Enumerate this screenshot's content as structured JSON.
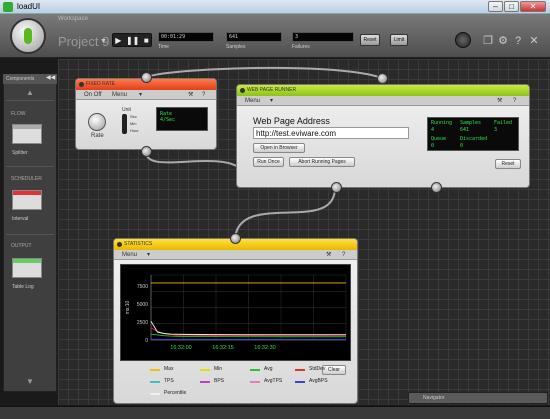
{
  "window": {
    "title": "loadUI"
  },
  "toolbar": {
    "workspace_label": "Workspace",
    "project_name": "Project 9",
    "time_value": "00:01:29",
    "time_label": "Time",
    "samples_value": "641",
    "samples_label": "Samples",
    "failures_value": "3",
    "failures_label": "Failures",
    "reset_label": "Reset",
    "limit_label": "Limit"
  },
  "sidebar": {
    "title": "Components",
    "sections": [
      {
        "label": "FLOW",
        "item": "Splitter"
      },
      {
        "label": "SCHEDULER",
        "item": "Interval"
      },
      {
        "label": "OUTPUT",
        "item": "Table Log"
      }
    ]
  },
  "fixed_rate": {
    "title": "FIXED RATE",
    "menu_label": "Menu",
    "onoff_label": "On Off",
    "unit_label": "Unit",
    "unit_options": [
      "Sec",
      "Min",
      "Hour"
    ],
    "rate_label": "Rate",
    "display_line1": "Rate",
    "display_line2": "4/Sec"
  },
  "web_runner": {
    "title": "WEB PAGE RUNNER",
    "menu_label": "Menu",
    "address_label": "Web Page Address",
    "address_value": "http://test.eviware.com",
    "open_browser_label": "Open in Browser",
    "run_once_label": "Run Once",
    "abort_label": "Abort Running Pages",
    "reset_label": "Reset",
    "stats": {
      "running_label": "Running",
      "running_value": "4",
      "samples_label": "Samples",
      "samples_value": "641",
      "failed_label": "Failed",
      "failed_value": "3",
      "queue_label": "Queue",
      "queue_value": "0",
      "discarded_label": "Discarded",
      "discarded_value": "0"
    }
  },
  "statistics": {
    "title": "STATISTICS",
    "menu_label": "Menu",
    "clear_label": "Clear",
    "legend": [
      {
        "name": "Max",
        "color": "#f0c000"
      },
      {
        "name": "Min",
        "color": "#e8e000"
      },
      {
        "name": "Avg",
        "color": "#30c030"
      },
      {
        "name": "StdDev",
        "color": "#e03030"
      },
      {
        "name": "TPS",
        "color": "#40c0c0"
      },
      {
        "name": "BPS",
        "color": "#c040c0"
      },
      {
        "name": "AvgTPS",
        "color": "#e080c0"
      },
      {
        "name": "AvgBPS",
        "color": "#4040e0"
      },
      {
        "name": "Percentile",
        "color": "#f0f0f0"
      }
    ]
  },
  "chart_data": {
    "type": "line",
    "ylabel": "ms:10",
    "y_ticks": [
      "7500",
      "5000",
      "2500",
      "0"
    ],
    "x_ticks": [
      "16:32:00",
      "16:32:15",
      "16:32:30"
    ],
    "ylim": [
      0,
      9000
    ],
    "x": [
      0,
      2,
      4,
      6,
      8,
      10,
      15,
      20,
      30,
      40,
      50,
      60
    ],
    "series": [
      {
        "name": "Max",
        "color": "#f0c000",
        "values": [
          7900,
          7900,
          7900,
          7900,
          7900,
          7900,
          7900,
          7900,
          7900,
          7900,
          7900,
          7900
        ]
      },
      {
        "name": "StdDev",
        "color": "#e03030",
        "values": [
          1700,
          1200,
          900,
          750,
          700,
          680,
          650,
          630,
          610,
          600,
          590,
          580
        ]
      },
      {
        "name": "Avg",
        "color": "#30c030",
        "values": [
          800,
          700,
          600,
          550,
          520,
          500,
          480,
          470,
          460,
          450,
          445,
          440
        ]
      },
      {
        "name": "Percentile",
        "color": "#f0f0f0",
        "values": [
          2600,
          1100,
          900,
          820,
          800,
          780,
          760,
          750,
          740,
          740,
          735,
          730
        ]
      },
      {
        "name": "AvgBPS",
        "color": "#4040e0",
        "values": [
          100,
          100,
          100,
          100,
          100,
          100,
          100,
          100,
          100,
          100,
          100,
          100
        ]
      }
    ]
  },
  "navigator": {
    "label": "Navigator"
  }
}
